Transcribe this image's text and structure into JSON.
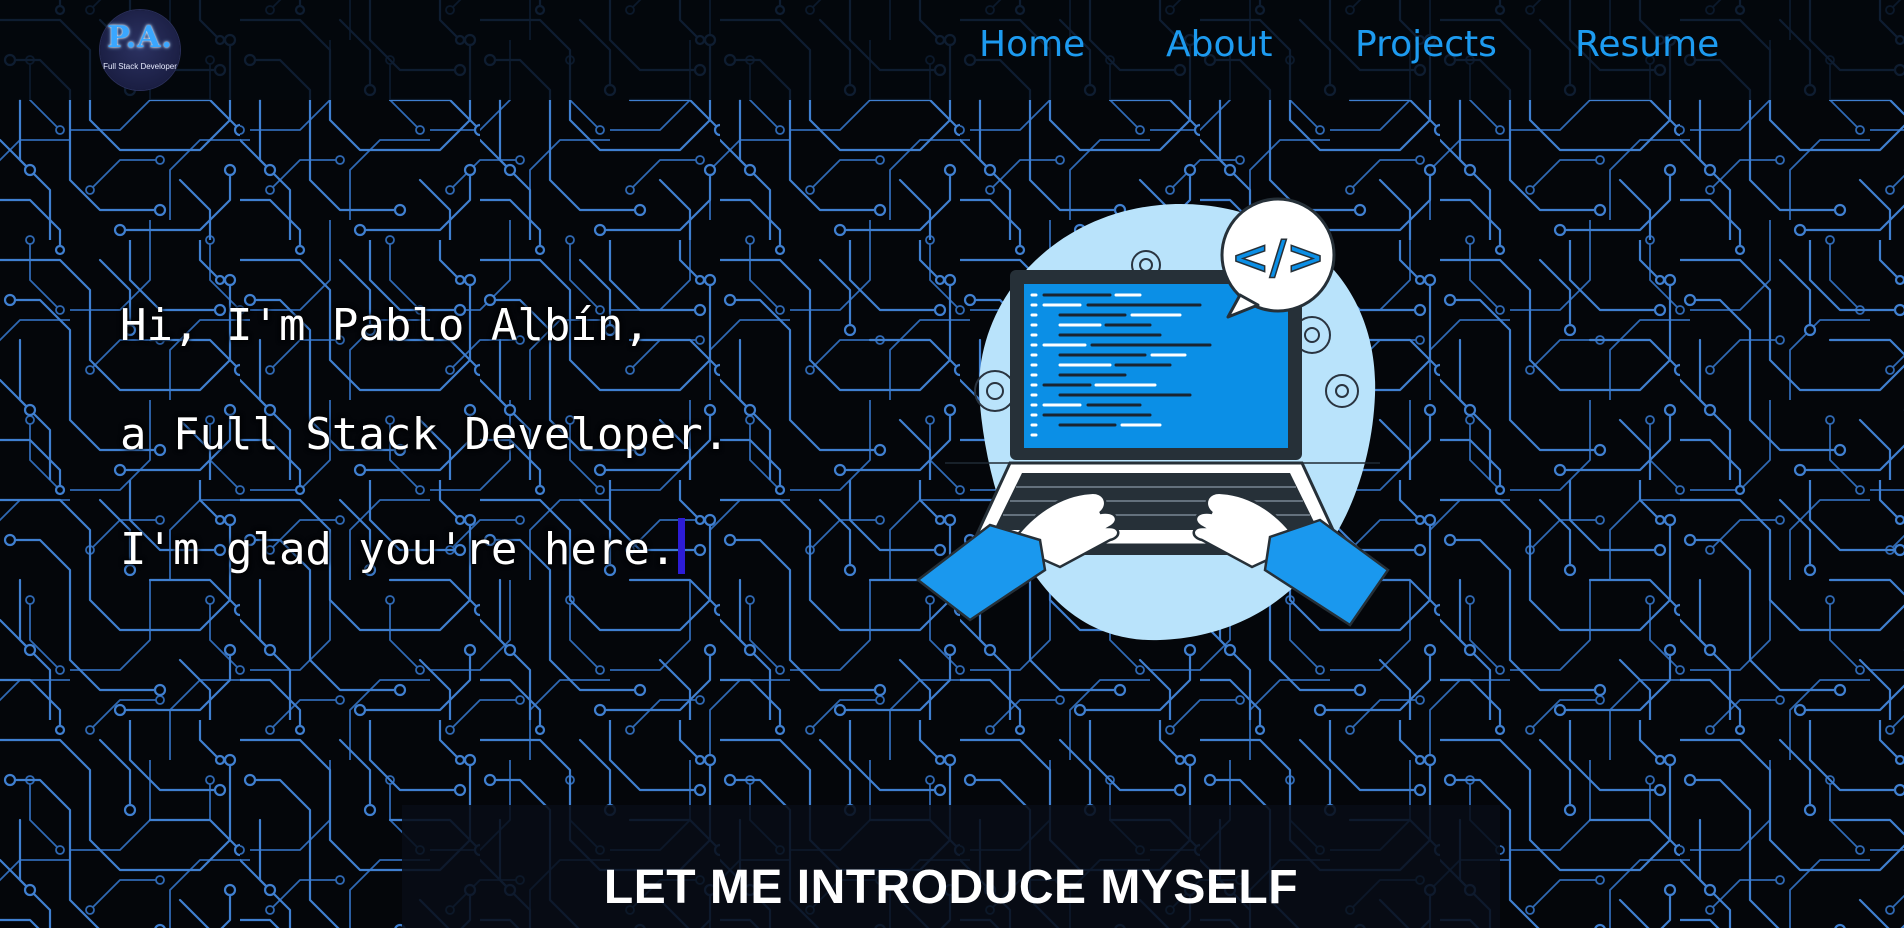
{
  "logo": {
    "initials": "P.A.",
    "subtitle": "Full Stack Developer"
  },
  "nav": {
    "links": [
      "Home",
      "About",
      "Projects",
      "Resume"
    ]
  },
  "hero": {
    "lines": [
      "Hi, I'm Pablo Albín,",
      "a Full Stack Developer.",
      "I'm glad you're here."
    ]
  },
  "illustration": {
    "icon": "laptop-coding-illustration",
    "code_tag": "</>"
  },
  "about": {
    "title": "LET ME INTRODUCE MYSELF"
  },
  "colors": {
    "accent": "#1d9bf0",
    "background": "#04060a",
    "circuit": "#3f7fd0",
    "caret": "#2d1cd6",
    "text": "#ffffff"
  }
}
